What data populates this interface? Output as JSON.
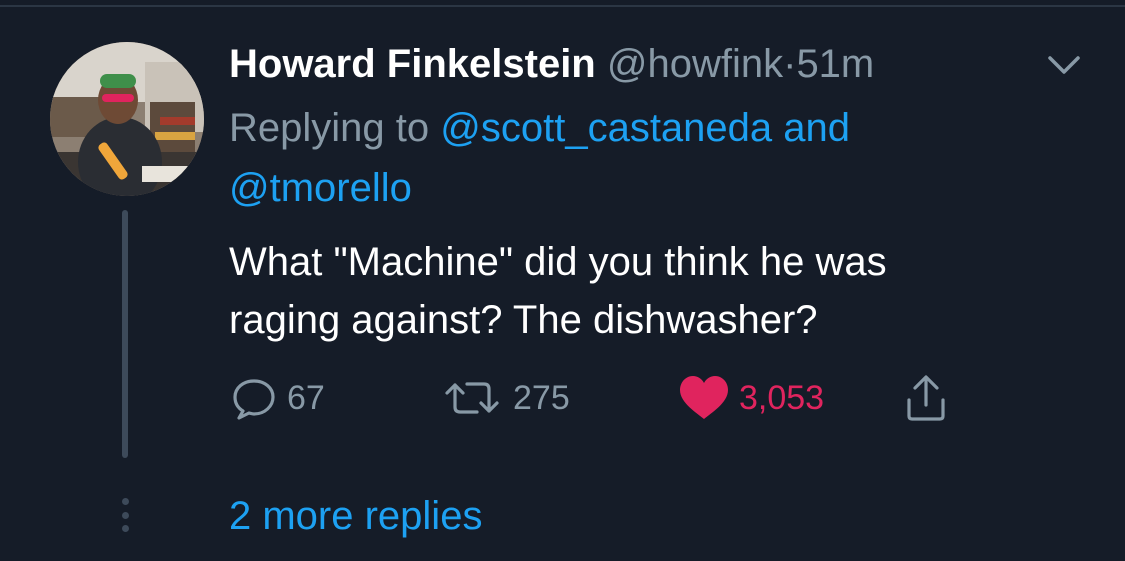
{
  "tweet": {
    "author": {
      "name": "Howard Finkelstein",
      "handle": "@howfink",
      "separator": "·",
      "time": "51m"
    },
    "reply_context": {
      "prefix": "Replying to",
      "mention_1": "@scott_castaneda",
      "conjunction": "and",
      "mention_2": "@tmorello"
    },
    "text_line_1": "What \"Machine\" did you think he was",
    "text_line_2": "raging against? The dishwasher?",
    "actions": {
      "reply_count": "67",
      "retweet_count": "275",
      "like_count": "3,053"
    },
    "more_replies": "2 more replies"
  },
  "colors": {
    "background": "#151c28",
    "primary_text": "#ffffff",
    "secondary_text": "#8899a6",
    "link": "#1da1f2",
    "like": "#e0245e",
    "thread_line": "#3d4a5a"
  },
  "icons": {
    "caret": "chevron-down-icon",
    "reply": "speech-bubble-icon",
    "retweet": "retweet-icon",
    "like": "heart-icon",
    "share": "share-icon"
  }
}
